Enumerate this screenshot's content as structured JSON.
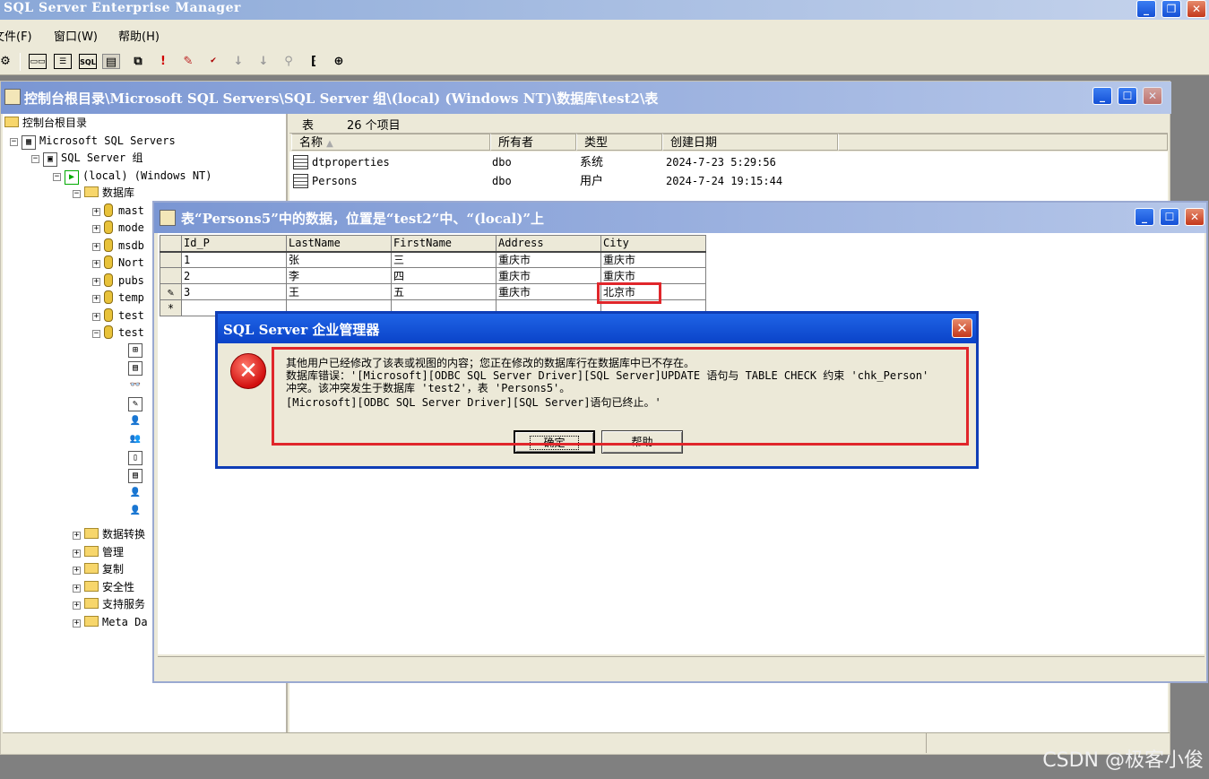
{
  "app": {
    "title": "SQL Server Enterprise Manager"
  },
  "menu": {
    "items": [
      "文件(F)",
      "窗口(W)",
      "帮助(H)"
    ]
  },
  "toolbar": {
    "icons": [
      "properties",
      "console-tree",
      "list",
      "sql",
      "detail",
      "new-window",
      "run",
      "wizard",
      "check",
      "sort-asc",
      "sort-desc",
      "filter",
      "indent",
      "add"
    ]
  },
  "tree_window": {
    "title": "控制台根目录\\Microsoft SQL Servers\\SQL Server 组\\(local) (Windows NT)\\数据库\\test2\\表",
    "root": "控制台根目录",
    "servers": "Microsoft SQL Servers",
    "group": "SQL Server 组",
    "local": "(local) (Windows NT)",
    "databases": "数据库",
    "db_list": [
      "mast",
      "mode",
      "msdb",
      "Nort",
      "pubs",
      "temp",
      "test",
      "test"
    ],
    "folders": [
      "数据转换",
      "管理",
      "复制",
      "安全性",
      "支持服务",
      "Meta Da"
    ],
    "list_header": {
      "label": "表",
      "count": "26 个项目"
    },
    "columns": [
      "名称",
      "所有者",
      "类型",
      "创建日期"
    ],
    "rows": [
      {
        "name": "dtproperties",
        "owner": "dbo",
        "type": "系统",
        "date": "2024-7-23 5:29:56"
      },
      {
        "name": "Persons",
        "owner": "dbo",
        "type": "用户",
        "date": "2024-7-24 19:15:44"
      }
    ]
  },
  "data_window": {
    "title": "表“Persons5”中的数据，位置是“test2”中、“(local)”上",
    "columns": [
      "Id_P",
      "LastName",
      "FirstName",
      "Address",
      "City"
    ],
    "rows": [
      {
        "marker": "",
        "id": "1",
        "last": "张",
        "first": "三",
        "address": "重庆市",
        "city": "重庆市"
      },
      {
        "marker": "",
        "id": "2",
        "last": "李",
        "first": "四",
        "address": "重庆市",
        "city": "重庆市"
      },
      {
        "marker": "✎",
        "id": "3",
        "last": "王",
        "first": "五",
        "address": "重庆市",
        "city": "北京市"
      }
    ],
    "new_row_marker": "*"
  },
  "dialog": {
    "title": "SQL Server 企业管理器",
    "line1": "其他用户已经修改了该表或视图的内容；您正在修改的数据库行在数据库中已不存在。",
    "line2": "数据库错误：'[Microsoft][ODBC SQL Server Driver][SQL Server]UPDATE 语句与 TABLE CHECK 约束 'chk_Person'",
    "line3": "冲突。该冲突发生于数据库 'test2'，表 'Persons5'。",
    "line4": "[Microsoft][ODBC SQL Server Driver][SQL Server]语句已终止。'",
    "ok_label": "确定",
    "help_label": "帮助"
  },
  "watermark": "CSDN @极客小俊",
  "colors": {
    "highlight": "#e0262b",
    "title_blue": "#0a43c8"
  }
}
